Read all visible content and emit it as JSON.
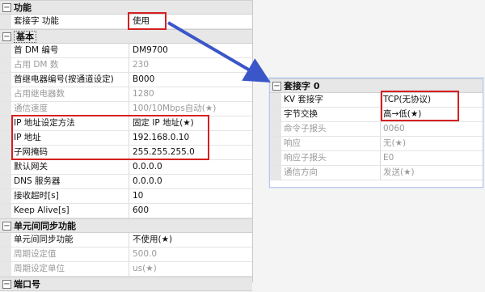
{
  "left_grid": {
    "categories": {
      "function": "功能",
      "basic": "基本",
      "unit_sync": "单元间同步功能",
      "port": "端口号"
    },
    "function_rows": [
      {
        "label": "套接字 功能",
        "value": "使用"
      }
    ],
    "basic_rows": [
      {
        "label": "首 DM 编号",
        "value": "DM9700"
      },
      {
        "label": "占用 DM 数",
        "value": "230"
      },
      {
        "label": "首继电器编号(按通道设定)",
        "value": "B000"
      },
      {
        "label": "占用继电器数",
        "value": "1280"
      },
      {
        "label": "通信速度",
        "value": "100/10Mbps自动(★)"
      },
      {
        "label": "IP 地址设定方法",
        "value": "固定 IP 地址(★)"
      },
      {
        "label": "IP 地址",
        "value": "192.168.0.10"
      },
      {
        "label": "子网掩码",
        "value": "255.255.255.0"
      },
      {
        "label": "默认网关",
        "value": "0.0.0.0"
      },
      {
        "label": "DNS 服务器",
        "value": "0.0.0.0"
      },
      {
        "label": "接收超时[s]",
        "value": "10"
      },
      {
        "label": "Keep Alive[s]",
        "value": "600"
      }
    ],
    "sync_rows": [
      {
        "label": "单元间同步功能",
        "value": "不使用(★)"
      },
      {
        "label": "周期设定值",
        "value": "500.0"
      },
      {
        "label": "周期设定单位",
        "value": "us(★)"
      }
    ]
  },
  "right_grid": {
    "category": "套接字 0",
    "rows": [
      {
        "label": "KV 套接字",
        "value": "TCP(无协议)"
      },
      {
        "label": "字节交换",
        "value": "高→低(★)"
      },
      {
        "label": "命令子报头",
        "value": "0060"
      },
      {
        "label": "响应",
        "value": "无(★)"
      },
      {
        "label": "响应子报头",
        "value": "E0"
      },
      {
        "label": "通信方向",
        "value": "发送(★)"
      }
    ]
  },
  "colors": {
    "highlight": "#d62020",
    "arrow": "#3b56c8"
  }
}
